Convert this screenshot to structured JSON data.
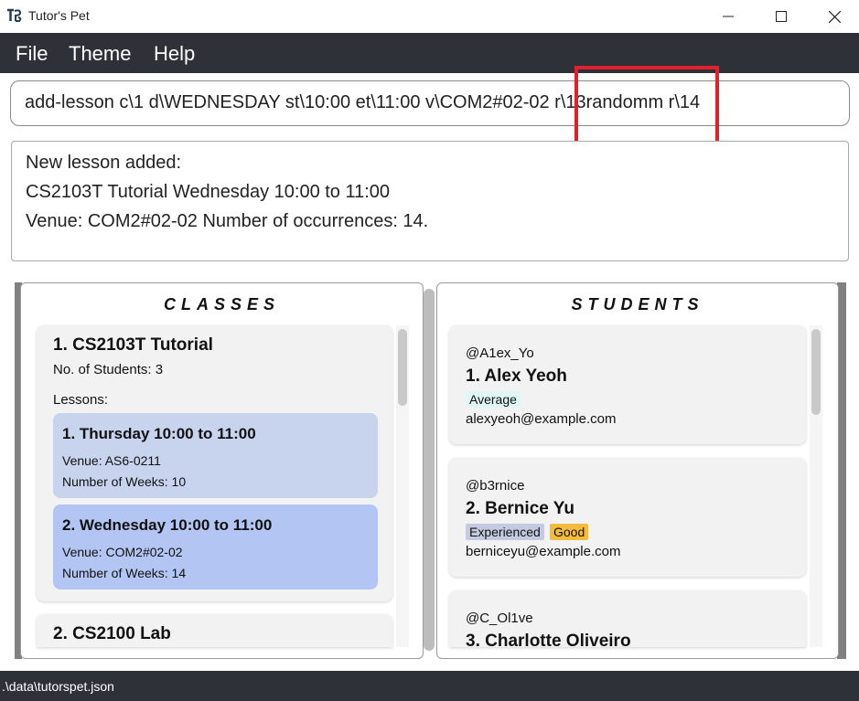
{
  "window": {
    "title": "Tutor's Pet",
    "minimize_symbol": "—",
    "maximize_symbol": "☐",
    "close_symbol": "✕"
  },
  "menu": {
    "items": [
      "File",
      "Theme",
      "Help"
    ]
  },
  "command": {
    "value": "add-lesson c\\1 d\\WEDNESDAY st\\10:00 et\\11:00 v\\COM2#02-02 r\\13randomm r\\14",
    "highlight_color": "#e0202a"
  },
  "result": {
    "lines": [
      "New lesson added:",
      "CS2103T Tutorial Wednesday 10:00 to 11:00",
      "Venue: COM2#02-02 Number of occurrences: 14."
    ]
  },
  "classes": {
    "heading": "CLASSES",
    "items": [
      {
        "title": "1.  CS2103T Tutorial",
        "students_label": "No. of Students:  3",
        "lessons_label": "Lessons:",
        "lessons": [
          {
            "title": "1. Thursday 10:00 to 11:00",
            "venue": "Venue: AS6-0211",
            "weeks": "Number of Weeks: 10",
            "color": "#c8d3ee"
          },
          {
            "title": "2. Wednesday 10:00 to 11:00",
            "venue": "Venue: COM2#02-02",
            "weeks": "Number of Weeks: 14",
            "color": "#b3c5f2"
          }
        ]
      },
      {
        "title": "2.  CS2100 Lab"
      }
    ]
  },
  "students": {
    "heading": "STUDENTS",
    "items": [
      {
        "handle": "@A1ex_Yo",
        "name": "1.  Alex Yeoh",
        "tags": [
          {
            "label": "Average",
            "color": "#dff6f4"
          }
        ],
        "email": "alexyeoh@example.com"
      },
      {
        "handle": "@b3rnice",
        "name": "2.  Bernice Yu",
        "tags": [
          {
            "label": "Experienced",
            "color": "#c4cbe0"
          },
          {
            "label": "Good",
            "color": "#f5bc3c"
          }
        ],
        "email": "berniceyu@example.com"
      },
      {
        "handle": "@C_Ol1ve",
        "name": "3.  Charlotte Oliveiro"
      }
    ]
  },
  "status": {
    "path": ".\\data\\tutorspet.json"
  },
  "colors": {
    "dark_bar": "#2e3137",
    "card_bg": "#f2f2f2"
  }
}
